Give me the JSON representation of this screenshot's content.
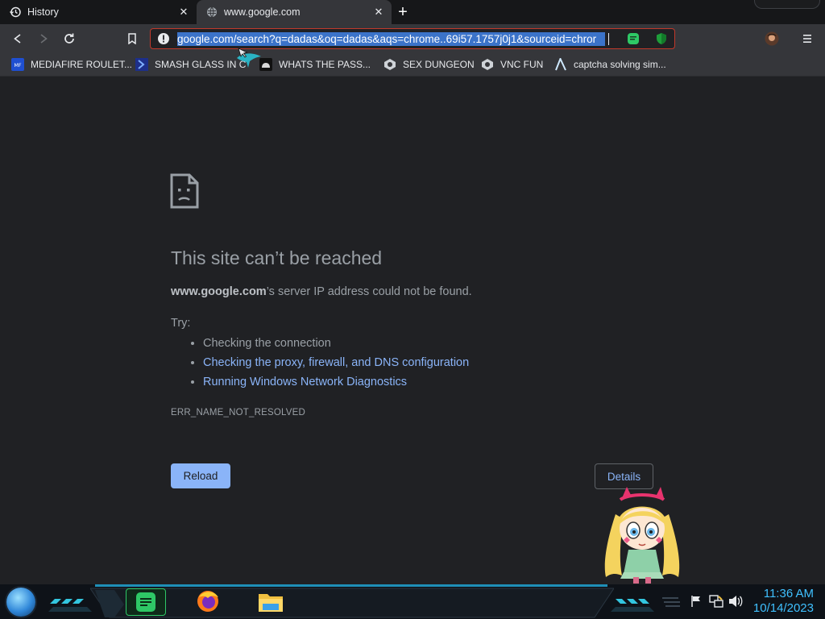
{
  "tabs": [
    {
      "label": "History",
      "icon": "history-icon",
      "close": "✕"
    },
    {
      "label": "www.google.com",
      "icon": "globe-icon",
      "close": "✕"
    }
  ],
  "new_tab": "+",
  "toolbar": {
    "url": "google.com/search?q=dadas&oq=dadas&aqs=chrome..69i57.1757j0j1&sourceid=chror"
  },
  "bookmarks": [
    {
      "label": "MEDIAFIRE ROULET...",
      "icon": "mediafire-icon"
    },
    {
      "label": "SMASH GLASS IN C",
      "icon": "chevron-bookmark-icon"
    },
    {
      "label": "WHATS THE PASS...",
      "icon": "robot-icon"
    },
    {
      "label": "SEX DUNGEON",
      "icon": "penguin-icon"
    },
    {
      "label": "VNC FUN",
      "icon": "penguin-icon"
    },
    {
      "label": "captcha solving sim...",
      "icon": "lambda-icon"
    }
  ],
  "error": {
    "title": "This site can’t be reached",
    "domain": "www.google.com",
    "message": "’s server IP address could not be found.",
    "try_label": "Try:",
    "suggestions": [
      "Checking the connection",
      "Checking the proxy, firewall, and DNS configuration",
      "Running Windows Network Diagnostics"
    ],
    "code": "ERR_NAME_NOT_RESOLVED",
    "reload_label": "Reload",
    "details_label": "Details"
  },
  "taskbar": {
    "time": "11:36 AM",
    "date": "10/14/2023"
  },
  "colors": {
    "background": "#202124",
    "link": "#8ab4f8",
    "url_selection": "#3b73c9",
    "omnibox_border": "#c0392b",
    "clock": "#3fc0ff"
  }
}
